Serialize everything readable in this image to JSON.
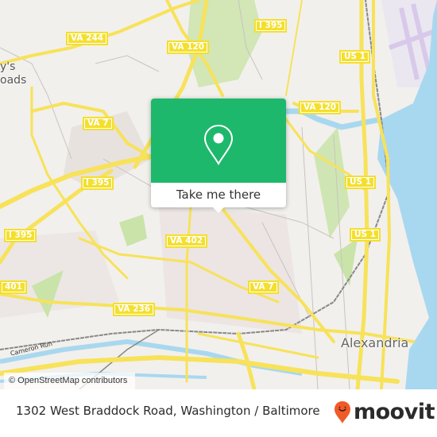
{
  "map": {
    "shields": [
      {
        "label": "VA 244",
        "id": "va-244"
      },
      {
        "label": "VA 120",
        "id": "va-120-north"
      },
      {
        "label": "I 395",
        "id": "i-395-north"
      },
      {
        "label": "VA 120",
        "id": "va-120-east"
      },
      {
        "label": "US 1",
        "id": "us-1-north"
      },
      {
        "label": "VA 7",
        "id": "va-7-west"
      },
      {
        "label": "I 395",
        "id": "i-395-center"
      },
      {
        "label": "I 395",
        "id": "i-395-west"
      },
      {
        "label": "US 1",
        "id": "us-1-mid"
      },
      {
        "label": "VA 402",
        "id": "va-402"
      },
      {
        "label": "US 1",
        "id": "us-1-south"
      },
      {
        "label": "VA 7",
        "id": "va-7-east"
      },
      {
        "label": "401",
        "id": "va-401"
      },
      {
        "label": "VA 236",
        "id": "va-236"
      }
    ],
    "places": {
      "baileys": "y's\noads",
      "alexandria": "Alexandria"
    },
    "water_labels": {
      "cameron_run": "Cameron Run",
      "cameron_run_2": "ameron Run"
    },
    "attribution": "© OpenStreetMap contributors"
  },
  "popup": {
    "icon": "map-pin-icon",
    "button_label": "Take me there"
  },
  "footer": {
    "address": "1302 West Braddock Road, Washington / Baltimore",
    "brand": "moovit",
    "colors": {
      "accent_green": "#1db86c",
      "brand_orange": "#f05a28",
      "road_yellow": "#f4df2c",
      "water_blue": "#a8d8ef"
    }
  }
}
